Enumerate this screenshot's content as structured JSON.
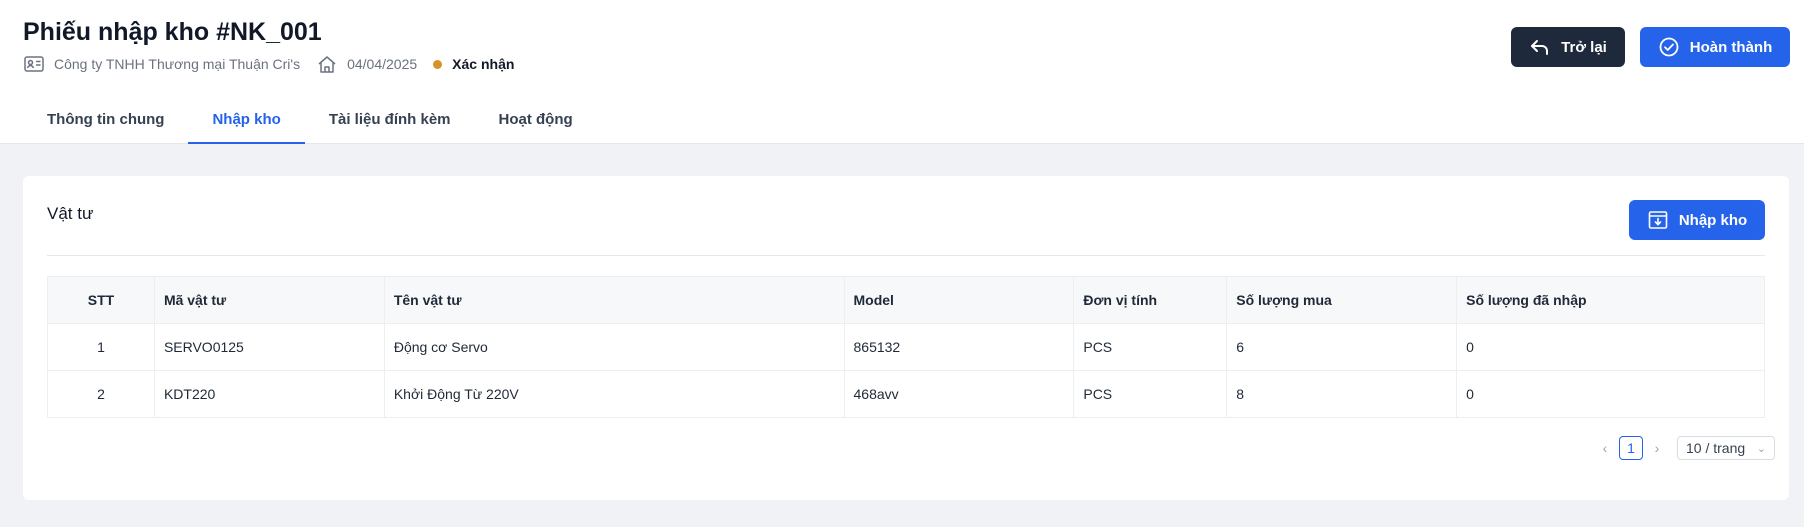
{
  "header": {
    "title": "Phiếu nhập kho #NK_001",
    "company": "Công ty TNHH Thương mại Thuận Cri's",
    "date": "04/04/2025",
    "status": "Xác nhận",
    "status_color": "#d4942a",
    "back_label": "Trở lại",
    "done_label": "Hoàn thành"
  },
  "tabs": [
    {
      "label": "Thông tin chung",
      "active": false
    },
    {
      "label": "Nhập kho",
      "active": true
    },
    {
      "label": "Tài liệu đính kèm",
      "active": false
    },
    {
      "label": "Hoạt động",
      "active": false
    }
  ],
  "card": {
    "title": "Vật tư",
    "import_label": "Nhập kho"
  },
  "table": {
    "columns": [
      "STT",
      "Mã vật tư",
      "Tên vật tư",
      "Model",
      "Đơn vị tính",
      "Số lượng mua",
      "Số lượng đã nhập"
    ],
    "rows": [
      [
        "1",
        "SERVO0125",
        "Động cơ Servo",
        "865132",
        "PCS",
        "6",
        "0"
      ],
      [
        "2",
        "KDT220",
        "Khởi Động Từ 220V",
        "468avv",
        "PCS",
        "8",
        "0"
      ]
    ]
  },
  "pagination": {
    "current_page": "1",
    "page_size": "10 / trang"
  },
  "colors": {
    "primary": "#2563eb",
    "dark_button": "#1e2a3b",
    "background": "#f0f2f5"
  },
  "icons": {
    "company": "id-card-icon",
    "date": "home-icon",
    "back": "undo-arrow-icon",
    "done": "check-circle-icon",
    "import": "inbox-download-icon"
  }
}
